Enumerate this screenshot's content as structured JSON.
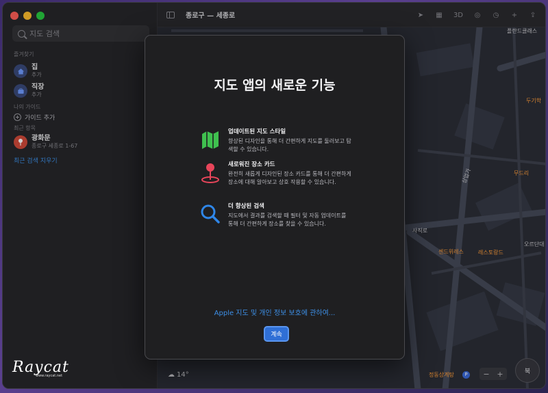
{
  "window": {
    "title": "종로구 — 세종로"
  },
  "sidebar": {
    "search_placeholder": "지도 검색",
    "favorites_header": "즐겨찾기",
    "favorites": [
      {
        "label": "집",
        "sub": "추가",
        "icon": "home-icon"
      },
      {
        "label": "직장",
        "sub": "추가",
        "icon": "briefcase-icon"
      }
    ],
    "my_guides_header": "나의 가이드",
    "add_guide_label": "가이드 추가",
    "recents_header": "최근 항목",
    "recents": [
      {
        "label": "광화문",
        "sub": "종로구 세종로 1-67",
        "icon": "pin-icon"
      }
    ],
    "clear_recents_label": "최근 검색 지우기"
  },
  "toolbar": {
    "icons": [
      "location-arrow-icon",
      "map-mode-icon",
      "3d-label",
      "binoculars-icon",
      "clock-icon",
      "add-icon",
      "share-icon"
    ],
    "three_d_label": "3D"
  },
  "map": {
    "labels": [
      {
        "text": "플란드클래스",
        "kind": "poi-gray"
      },
      {
        "text": "두기학",
        "kind": "poi"
      },
      {
        "text": "무드리",
        "kind": "poi"
      },
      {
        "text": "사직로",
        "kind": "road"
      },
      {
        "text": "상업가",
        "kind": "road"
      },
      {
        "text": "센드위레스",
        "kind": "poi"
      },
      {
        "text": "레스토랑드",
        "kind": "poi"
      },
      {
        "text": "오르단대",
        "kind": "road"
      },
      {
        "text": "정동상계탕",
        "kind": "poi"
      }
    ],
    "temperature": "14°",
    "compass_label": "북",
    "zoom_minus": "−",
    "zoom_plus": "+",
    "parking_label": "P"
  },
  "modal": {
    "title": "지도 앱의 새로운 기능",
    "features": [
      {
        "title": "업데이트된 지도 스타일",
        "desc": "향상된 디자인을 통해 더 간편하게 지도를 둘러보고 탐색할 수 있습니다.",
        "icon": "map-icon",
        "color": "#3fc04f"
      },
      {
        "title": "새로워진 장소 카드",
        "desc": "완전히 새롭게 디자인된 장소 카드를 통해 더 간편하게 장소에 대해 알아보고 상호 작용할 수 있습니다.",
        "icon": "location-pin-icon",
        "color": "#e8455a"
      },
      {
        "title": "더 향상된 검색",
        "desc": "지도에서 결과를 검색할 때 필터 및 자동 업데이트를 통해 더 간편하게 장소를 찾을 수 있습니다.",
        "icon": "magnifier-icon",
        "color": "#2f86e8"
      }
    ],
    "privacy_link": "Apple 지도 및 개인 정보 보호에 관하여...",
    "continue_label": "계속"
  },
  "watermark": {
    "logo": "Raycat",
    "sub": "www.raycat.net"
  }
}
